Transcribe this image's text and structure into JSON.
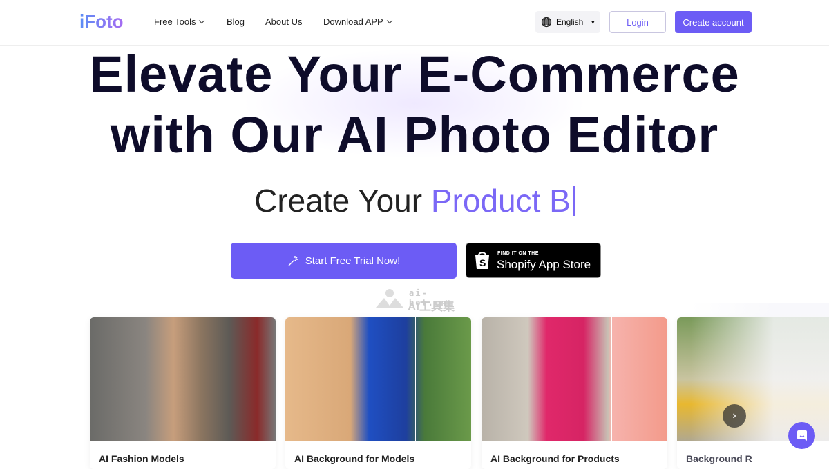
{
  "nav": {
    "logo": "iFoto",
    "items": [
      {
        "label": "Free Tools",
        "dropdown": true
      },
      {
        "label": "Blog"
      },
      {
        "label": "About Us"
      },
      {
        "label": "Download APP",
        "dropdown": true
      }
    ],
    "language": "English",
    "login": "Login",
    "create_account": "Create account"
  },
  "hero": {
    "title_line1": "Elevate Your E-Commerce",
    "title_line2": "with Our AI Photo Editor",
    "subtitle_prefix": "Create Your ",
    "subtitle_highlight": "Product B",
    "trial_button": "Start Free Trial Now!",
    "shopify_small": "FIND IT ON THE",
    "shopify_big": "Shopify App Store"
  },
  "watermark": {
    "line1": "ai-bot.cn",
    "line2": "AI工具集"
  },
  "cards": [
    {
      "title": "AI Fashion Models"
    },
    {
      "title": "AI Background for Models"
    },
    {
      "title": "AI Background for Products"
    },
    {
      "title": "Background R"
    }
  ],
  "colors": {
    "accent": "#6c5cf5"
  }
}
